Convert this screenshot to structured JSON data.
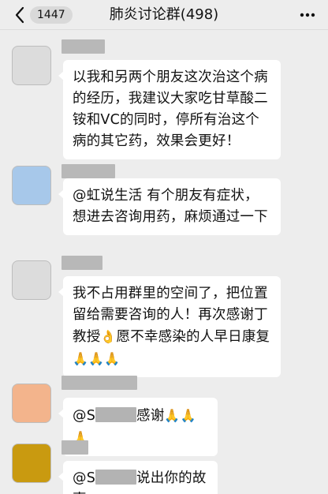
{
  "header": {
    "back_count": "1447",
    "title": "肺炎讨论群(498)"
  },
  "messages": [
    {
      "avatar_color": "#dcdcdc",
      "text": "以我和另两个朋友这次治这个病的经历，我建议大家吃甘草酸二铵和VC的同时，停所有治这个病的其它药，效果会更好！"
    },
    {
      "avatar_color": "#a7c8ea",
      "text": "@虹说生活 有个朋友有症状，想进去咨询用药，麻烦通过一下"
    },
    {
      "avatar_color": "#dcdcdc",
      "text": "我不占用群里的空间了，把位置留给需要咨询的人！再次感谢丁教授",
      "emoji_mid": "👌",
      "text_2": "愿不幸感染的人早日康复",
      "emoji_end": "🙏🙏🙏"
    },
    {
      "avatar_color": "#f3b48c",
      "prefix": "@S",
      "text": "感谢",
      "emoji_end": "🙏🙏🙏"
    },
    {
      "avatar_color": "#c99a10",
      "prefix": "@S",
      "text": "说出你的故事"
    }
  ]
}
